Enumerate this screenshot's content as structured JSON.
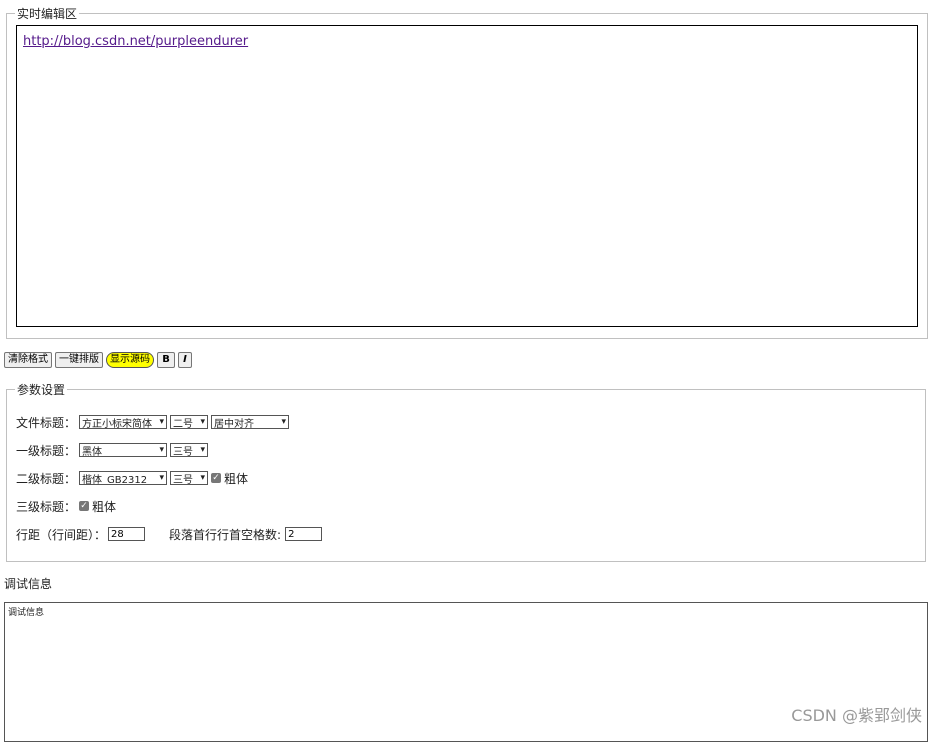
{
  "editor": {
    "legend": "实时编辑区",
    "link_text": "http://blog.csdn.net/purpleendurer"
  },
  "toolbar": {
    "clear_format": "清除格式",
    "one_click_layout": "一键排版",
    "show_source": "显示源码",
    "bold": "B",
    "italic": "I"
  },
  "params": {
    "legend": "参数设置",
    "doc_title": {
      "label": "文件标题：",
      "font": "方正小标宋简体",
      "size": "二号",
      "align": "居中对齐"
    },
    "h1": {
      "label": "一级标题：",
      "font": "黑体",
      "size": "三号"
    },
    "h2": {
      "label": "二级标题：",
      "font": "楷体_GB2312",
      "size": "三号",
      "bold_label": "粗体",
      "bold_checked": true
    },
    "h3": {
      "label": "三级标题：",
      "bold_label": "粗体",
      "bold_checked": true
    },
    "line_spacing_label": "行距（行间距）：",
    "line_spacing_value": "28",
    "indent_label": "段落首行行首空格数:",
    "indent_value": "2"
  },
  "debug": {
    "heading": "调试信息",
    "content": "调试信息"
  },
  "watermark": "CSDN @紫郢剑侠"
}
